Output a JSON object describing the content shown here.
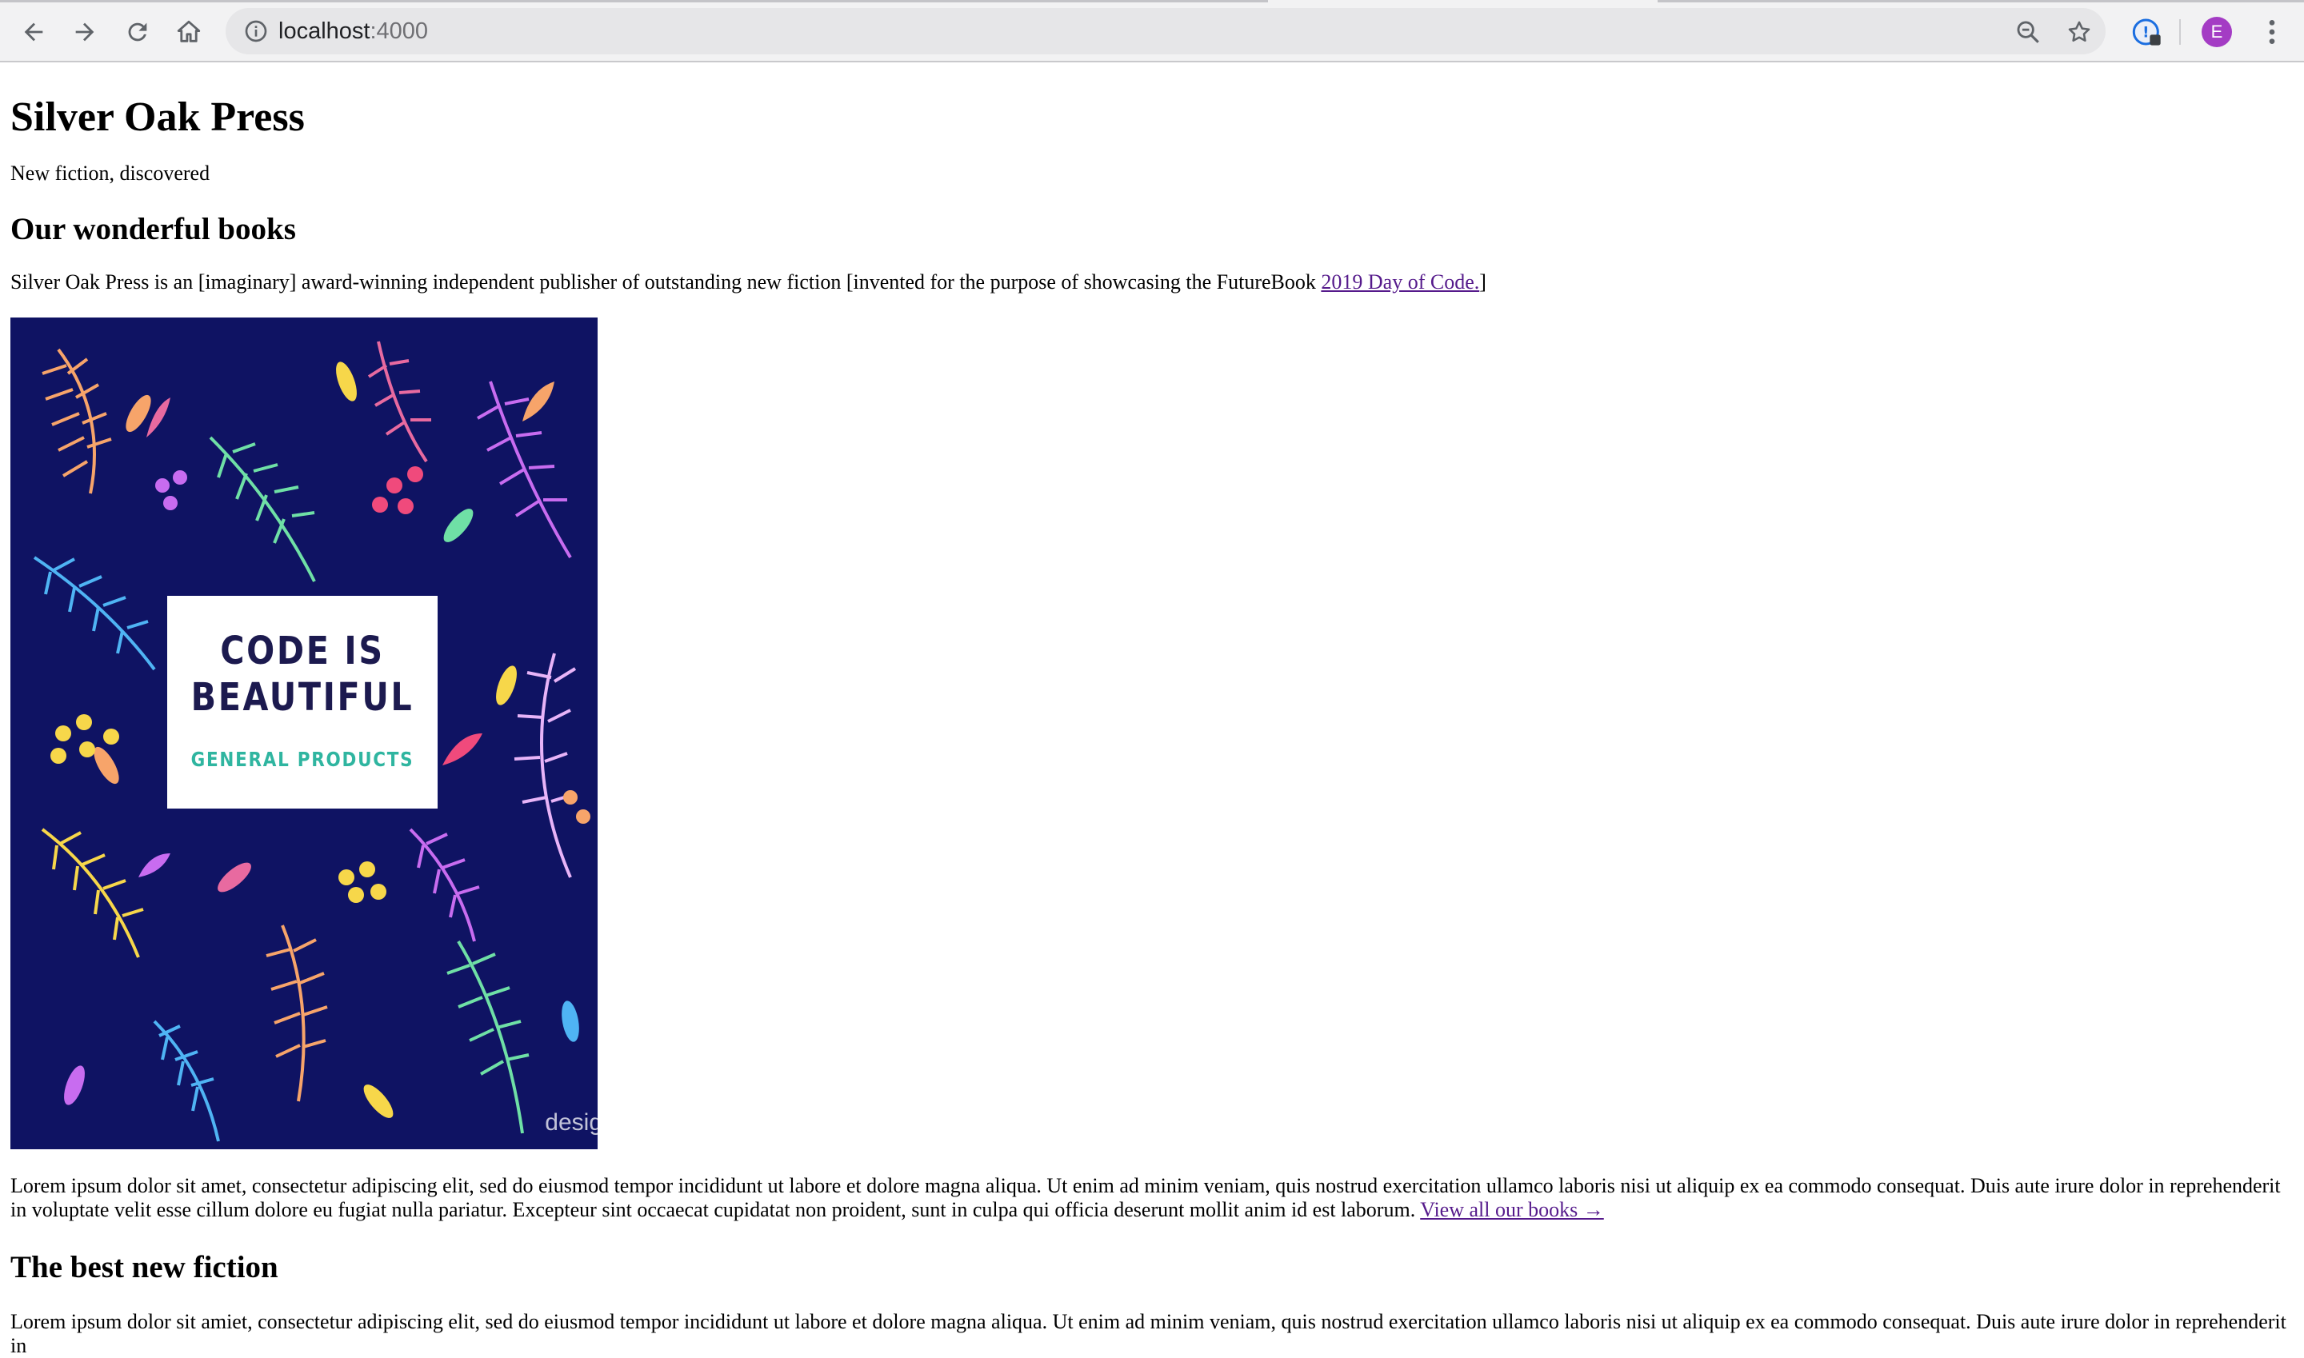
{
  "browser": {
    "url_host": "localhost",
    "url_port": ":4000",
    "profile_initial": "E",
    "icons": [
      "back-icon",
      "forward-icon",
      "reload-icon",
      "home-icon",
      "site-info-icon",
      "zoom-icon",
      "bookmark-star-icon",
      "extension-icon",
      "profile-avatar",
      "menu-icon"
    ]
  },
  "site": {
    "title": "Silver Oak Press",
    "tagline": "New fiction, discovered"
  },
  "books_section": {
    "heading": "Our wonderful books",
    "intro_text": "Silver Oak Press is an [imaginary] award-winning independent publisher of outstanding new fiction [invented for the purpose of showcasing the FutureBook ",
    "intro_link": "2019 Day of Code.",
    "intro_tail": "]",
    "cover": {
      "title": "CODE IS BEAUTIFUL",
      "subtitle": "GENERAL PRODUCTS",
      "watermark": "desig",
      "background_color": "#0f1363"
    },
    "body_text": "Lorem ipsum dolor sit amet, consectetur adipiscing elit, sed do eiusmod tempor incididunt ut labore et dolore magna aliqua. Ut enim ad minim veniam, quis nostrud exercitation ullamco laboris nisi ut aliquip ex ea commodo consequat. Duis aute irure dolor in reprehenderit in voluptate velit esse cillum dolore eu fugiat nulla pariatur. Excepteur sint occaecat cupidatat non proident, sunt in culpa qui officia deserunt mollit anim id est laborum. ",
    "view_all_link": "View all our books →"
  },
  "fiction_section": {
    "heading": "The best new fiction",
    "body_text": "Lorem ipsum dolor sit amiet, consectetur adipiscing elit, sed do eiusmod tempor incididunt ut labore et dolore magna aliqua. Ut enim ad minim veniam, quis nostrud exercitation ullamco laboris nisi ut aliquip ex ea commodo consequat. Duis aute irure dolor in reprehenderit in"
  },
  "colors": {
    "link": "#551a8b",
    "cover_navy": "#0f1363",
    "cover_title": "#1c1a4f",
    "cover_subtitle": "#2fb5a0",
    "avatar": "#a43cc4"
  }
}
